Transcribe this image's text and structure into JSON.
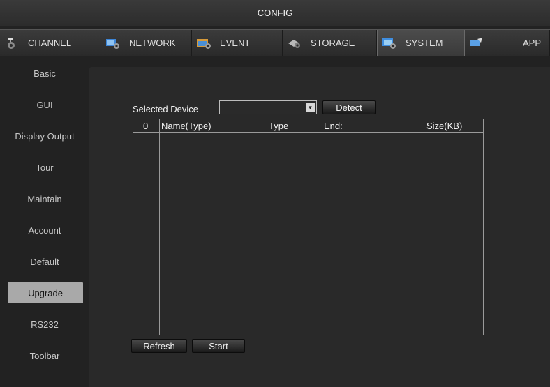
{
  "window": {
    "title": "CONFIG"
  },
  "tabs": [
    {
      "label": "CHANNEL",
      "icon": "channel-icon"
    },
    {
      "label": "NETWORK",
      "icon": "network-icon"
    },
    {
      "label": "EVENT",
      "icon": "event-icon"
    },
    {
      "label": "STORAGE",
      "icon": "storage-icon"
    },
    {
      "label": "SYSTEM",
      "icon": "system-icon",
      "active": true
    },
    {
      "label": "APP",
      "icon": "app-icon"
    }
  ],
  "sidebar": {
    "items": [
      {
        "label": "Basic"
      },
      {
        "label": "GUI"
      },
      {
        "label": "Display Output"
      },
      {
        "label": "Tour"
      },
      {
        "label": "Maintain"
      },
      {
        "label": "Account"
      },
      {
        "label": "Default"
      },
      {
        "label": "Upgrade",
        "selected": true
      },
      {
        "label": "RS232"
      },
      {
        "label": "Toolbar"
      }
    ]
  },
  "upgrade": {
    "selected_device_label": "Selected Device",
    "selected_device_value": "",
    "detect_label": "Detect",
    "table": {
      "count": "0",
      "columns": [
        "Name(Type)",
        "Type",
        "End:",
        "Size(KB)"
      ],
      "rows": []
    },
    "refresh_label": "Refresh",
    "start_label": "Start"
  },
  "colors": {
    "background": "#222222",
    "panel": "#292929",
    "selected_item": "#a9a9a9"
  }
}
